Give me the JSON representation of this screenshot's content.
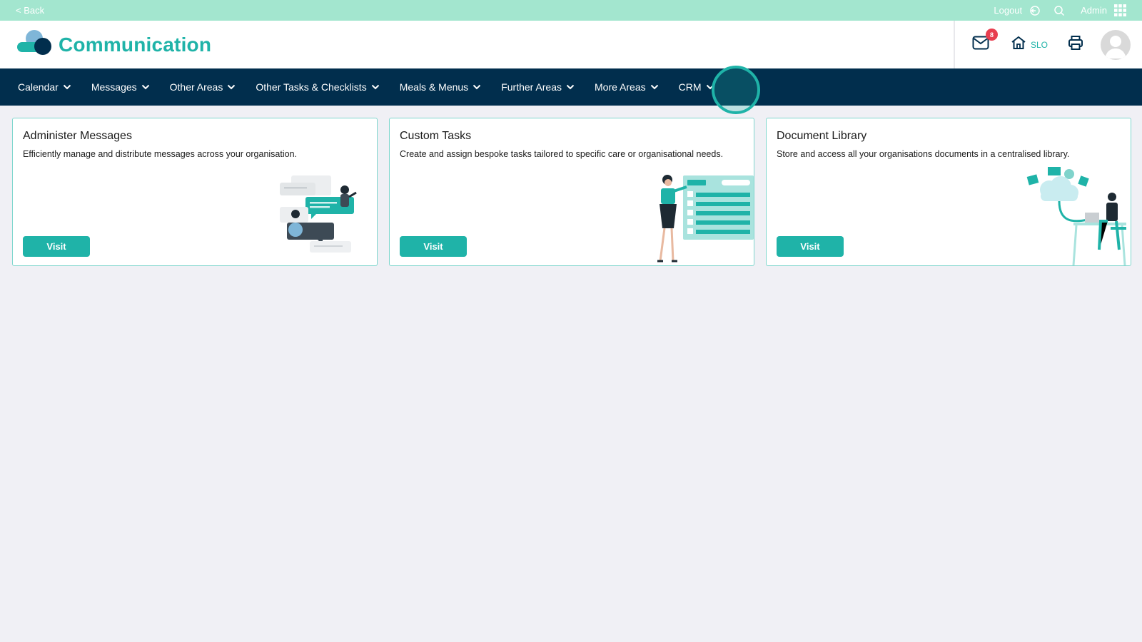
{
  "topbar": {
    "back_label": "< Back",
    "logout_label": "Logout",
    "user_label": "Admin"
  },
  "header": {
    "title": "Communication",
    "mail_badge": "8",
    "home_label": "SLO"
  },
  "nav": {
    "items": [
      {
        "label": "Calendar"
      },
      {
        "label": "Messages"
      },
      {
        "label": "Other Areas"
      },
      {
        "label": "Other Tasks & Checklists"
      },
      {
        "label": "Meals & Menus"
      },
      {
        "label": "Further Areas"
      },
      {
        "label": "More Areas"
      },
      {
        "label": "CRM"
      }
    ]
  },
  "cards": [
    {
      "title": "Administer Messages",
      "description": "Efficiently manage and distribute messages across your organisation.",
      "button": "Visit"
    },
    {
      "title": "Custom Tasks",
      "description": "Create and assign bespoke tasks tailored to specific care or organisational needs.",
      "button": "Visit"
    },
    {
      "title": "Document Library",
      "description": "Store and access all your organisations documents in a centralised library.",
      "button": "Visit"
    }
  ],
  "colors": {
    "topbar": "#a3e6cf",
    "brand": "#1fb3a8",
    "nav": "#012e4d",
    "badge": "#e83e4f",
    "background": "#f0f0f5"
  }
}
